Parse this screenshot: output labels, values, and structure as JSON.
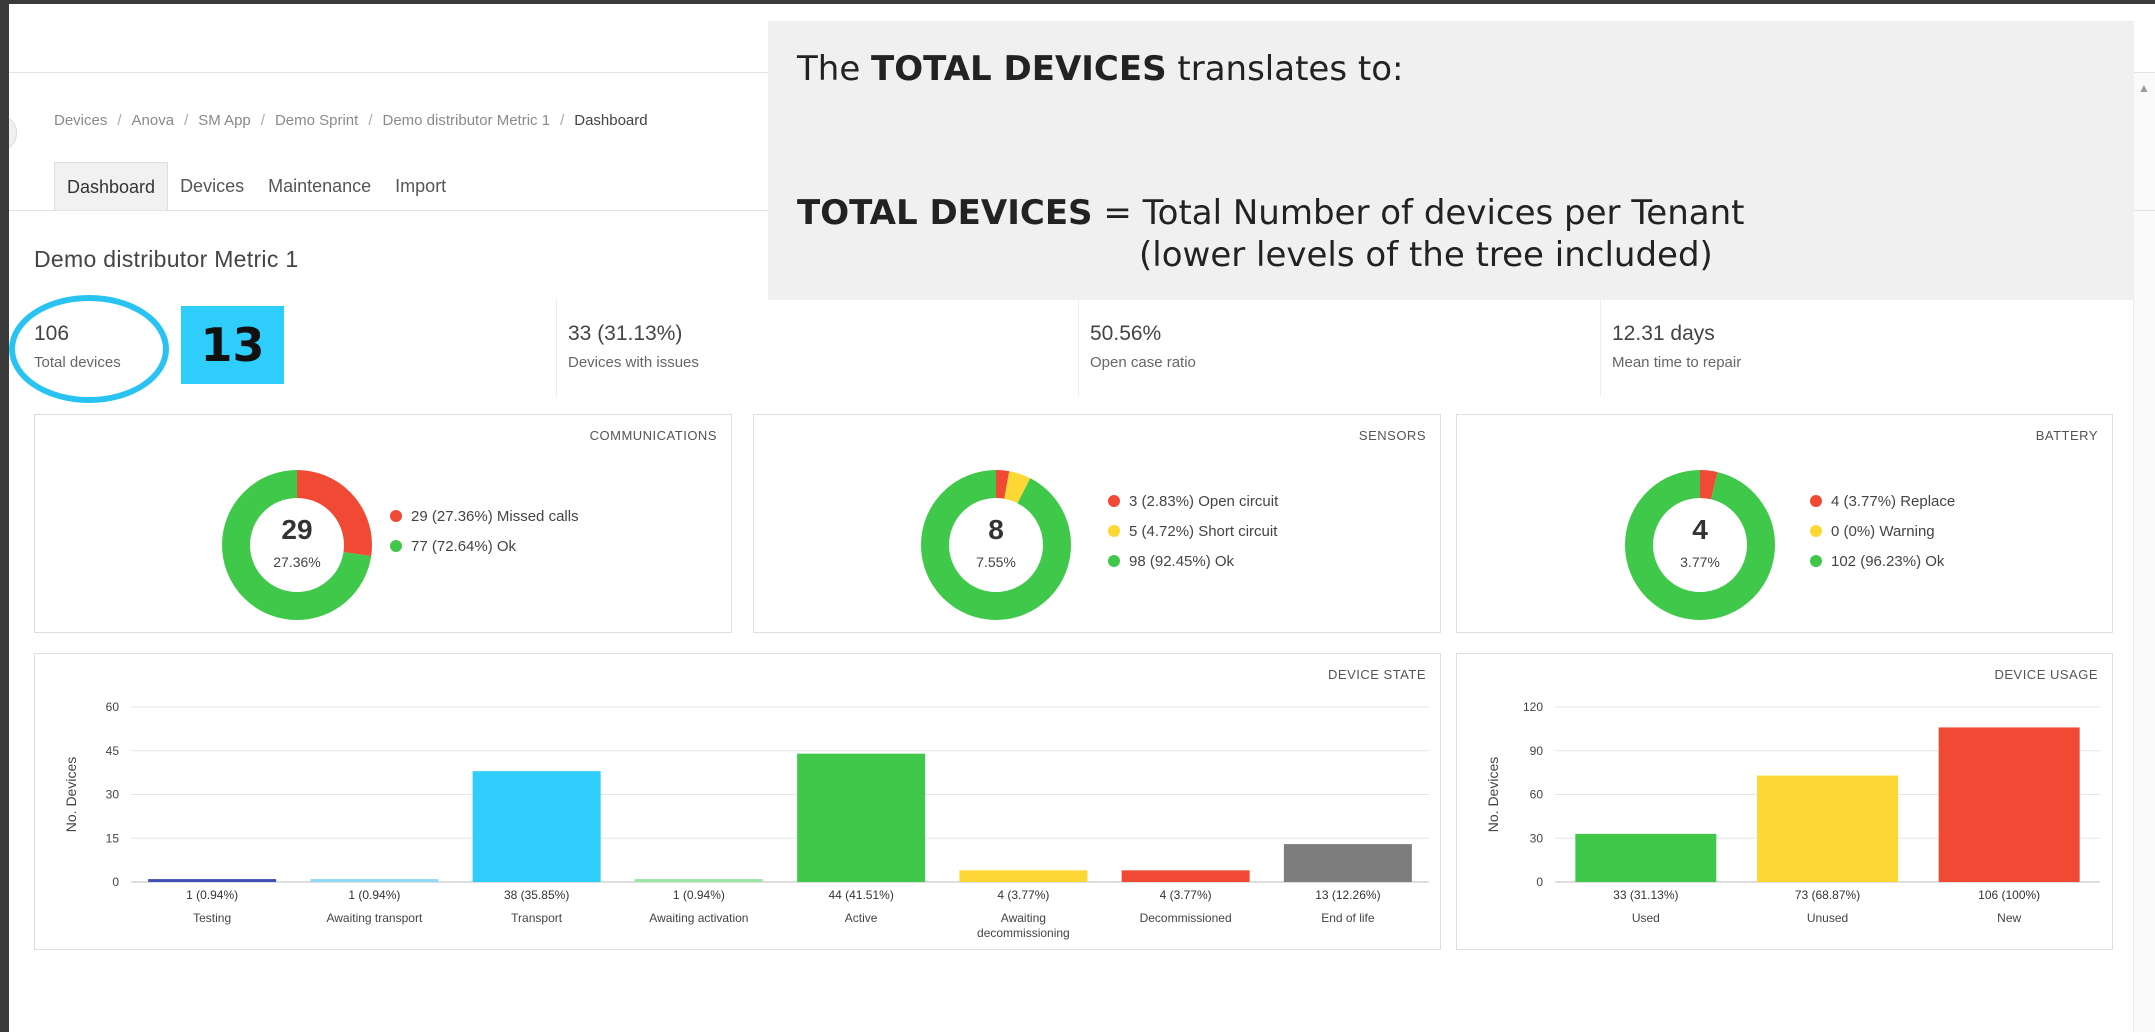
{
  "breadcrumb": [
    "Devices",
    "Anova",
    "SM App",
    "Demo Sprint",
    "Demo distributor Metric 1",
    "Dashboard"
  ],
  "tabs": [
    "Dashboard",
    "Devices",
    "Maintenance",
    "Import"
  ],
  "page_title": "Demo distributor Metric 1",
  "kpis": [
    {
      "value": "106",
      "label": "Total devices"
    },
    {
      "value": "33 (31.13%)",
      "label": "Devices with issues"
    },
    {
      "value": "50.56%",
      "label": "Open case ratio"
    },
    {
      "value": "12.31 days",
      "label": "Mean time to repair"
    }
  ],
  "highlight_count": "13",
  "note": {
    "line1_pre": "The ",
    "line1_bold": "TOTAL DEVICES",
    "line1_post": " translates to:",
    "line2_bold": "TOTAL DEVICES",
    "line2_post": " = Total Number of devices per Tenant",
    "line3": "(lower levels of the tree included)"
  },
  "communications": {
    "title": "COMMUNICATIONS",
    "center_value": "29",
    "center_pct": "27.36%",
    "legend": [
      {
        "label": "29 (27.36%)",
        "text": "Missed calls",
        "color": "#f04a35",
        "value": 29
      },
      {
        "label": "77 (72.64%)",
        "text": "Ok",
        "color": "#40c84a",
        "value": 77
      }
    ]
  },
  "sensors": {
    "title": "SENSORS",
    "center_value": "8",
    "center_pct": "7.55%",
    "legend": [
      {
        "label": "3 (2.83%)",
        "text": "Open circuit",
        "color": "#f04a35",
        "value": 3
      },
      {
        "label": "5 (4.72%)",
        "text": "Short circuit",
        "color": "#fdd835",
        "value": 5
      },
      {
        "label": "98 (92.45%)",
        "text": "Ok",
        "color": "#40c84a",
        "value": 98
      }
    ]
  },
  "battery": {
    "title": "BATTERY",
    "center_value": "4",
    "center_pct": "3.77%",
    "legend": [
      {
        "label": "4 (3.77%)",
        "text": "Replace",
        "color": "#f04a35",
        "value": 4
      },
      {
        "label": "0 (0%)",
        "text": "Warning",
        "color": "#fdd835",
        "value": 0
      },
      {
        "label": "102 (96.23%)",
        "text": "Ok",
        "color": "#40c84a",
        "value": 102
      }
    ]
  },
  "chart_data": [
    {
      "type": "bar",
      "title": "DEVICE STATE",
      "ylabel": "No. Devices",
      "ylim": [
        0,
        60
      ],
      "yticks": [
        0,
        15,
        30,
        45,
        60
      ],
      "categories": [
        "Testing",
        "Awaiting transport",
        "Transport",
        "Awaiting activation",
        "Active",
        "Awaiting decommissioning",
        "Decommissioned",
        "End of life"
      ],
      "category_lines": [
        [
          "Testing"
        ],
        [
          "Awaiting transport"
        ],
        [
          "Transport"
        ],
        [
          "Awaiting activation"
        ],
        [
          "Active"
        ],
        [
          "Awaiting",
          "decommissioning"
        ],
        [
          "Decommissioned"
        ],
        [
          "End of life"
        ]
      ],
      "values": [
        1,
        1,
        38,
        1,
        44,
        4,
        4,
        13
      ],
      "data_labels": [
        "1 (0.94%)",
        "1 (0.94%)",
        "38 (35.85%)",
        "1 (0.94%)",
        "44 (41.51%)",
        "4 (3.77%)",
        "4 (3.77%)",
        "13 (12.26%)"
      ],
      "colors": [
        "#3f51b5",
        "#8fd9f5",
        "#2ecdfc",
        "#9be6a3",
        "#40c84a",
        "#fdd835",
        "#f04a35",
        "#7d7d7d"
      ],
      "grid": true
    },
    {
      "type": "bar",
      "title": "DEVICE USAGE",
      "ylabel": "No. Devices",
      "ylim": [
        0,
        120
      ],
      "yticks": [
        0,
        30,
        60,
        90,
        120
      ],
      "categories": [
        "Used",
        "Unused",
        "New"
      ],
      "category_lines": [
        [
          "Used"
        ],
        [
          "Unused"
        ],
        [
          "New"
        ]
      ],
      "values": [
        33,
        73,
        106
      ],
      "data_labels": [
        "33 (31.13%)",
        "73 (68.87%)",
        "106 (100%)"
      ],
      "colors": [
        "#40c84a",
        "#fdd835",
        "#f04a35"
      ],
      "grid": true
    }
  ]
}
